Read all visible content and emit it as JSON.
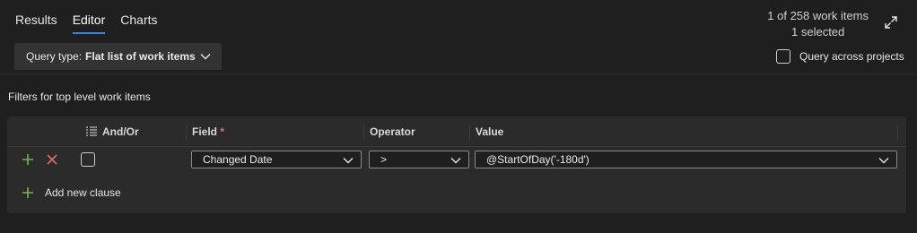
{
  "tabs": [
    {
      "label": "Results",
      "active": false
    },
    {
      "label": "Editor",
      "active": true
    },
    {
      "label": "Charts",
      "active": false
    }
  ],
  "counts": {
    "items": "1 of 258 work items",
    "selected": "1 selected"
  },
  "query_type": {
    "label": "Query type:",
    "value": "Flat list of work items"
  },
  "query_across_projects": {
    "label": "Query across projects",
    "checked": false
  },
  "filters_label": "Filters for top level work items",
  "table": {
    "headers": {
      "and_or": "And/Or",
      "field": "Field",
      "required_marker": "*",
      "operator": "Operator",
      "value": "Value"
    },
    "rows": [
      {
        "checked": false,
        "field": "Changed Date",
        "operator": ">",
        "value": "@StartOfDay('-180d')"
      }
    ],
    "add_clause_label": "Add new clause"
  },
  "colors": {
    "accent": "#2f8ae0",
    "add": "#7ab648",
    "remove": "#e06c6c",
    "background": "#1f1f1f",
    "panel": "#2b2b2b"
  },
  "icons": [
    "expand-icon",
    "chevron-down-icon",
    "group-clauses-icon",
    "plus-icon",
    "close-icon"
  ]
}
